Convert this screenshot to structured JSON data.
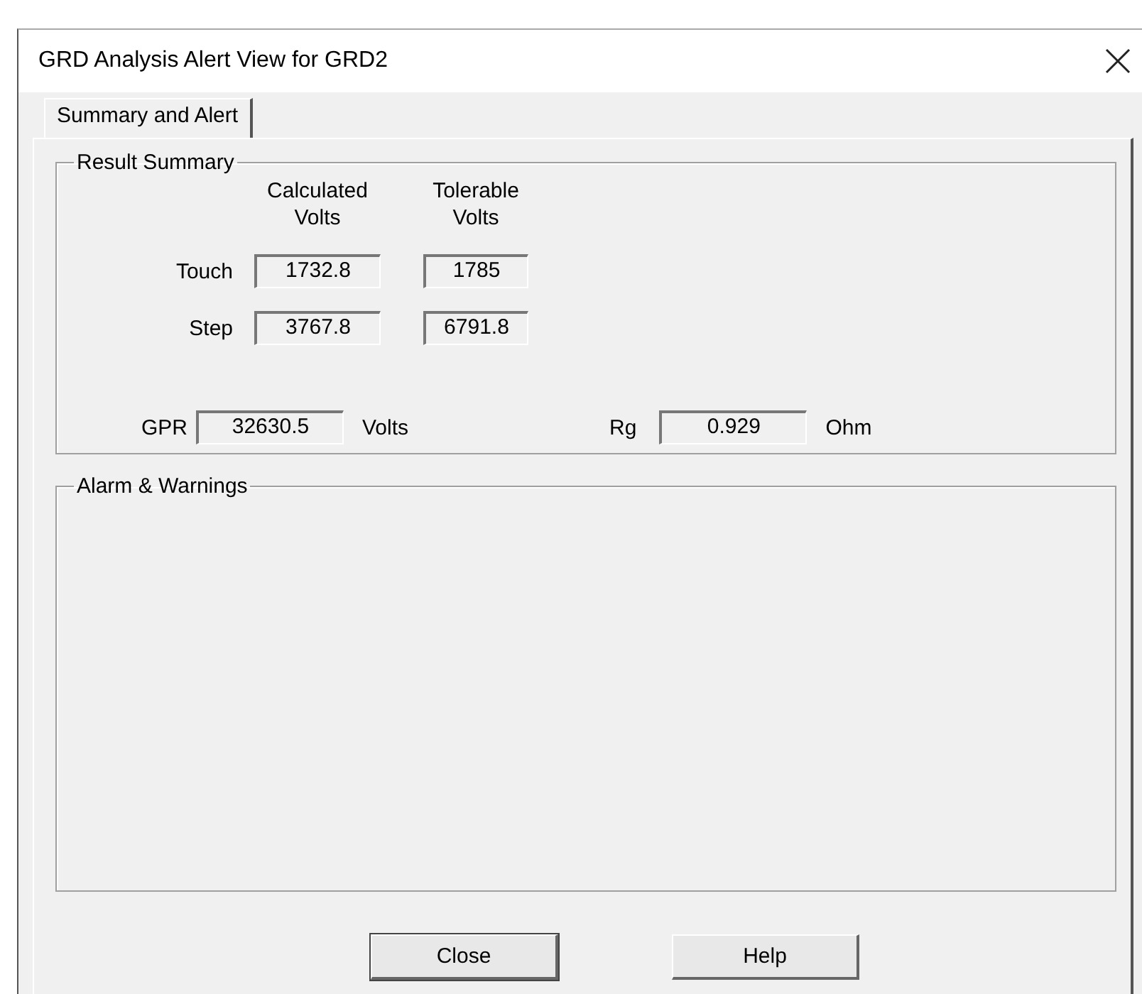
{
  "window": {
    "title": "GRD Analysis Alert View for GRD2"
  },
  "tabs": [
    {
      "label": "Summary and Alert",
      "selected": true
    }
  ],
  "result_summary": {
    "title": "Result Summary",
    "columns": [
      "Calculated\nVolts",
      "Tolerable\nVolts"
    ],
    "rows": [
      {
        "label": "Touch",
        "calculated": "1732.8",
        "tolerable": "1785"
      },
      {
        "label": "Step",
        "calculated": "3767.8",
        "tolerable": "6791.8"
      }
    ],
    "gpr": {
      "label": "GPR",
      "value": "32630.5",
      "unit": "Volts"
    },
    "rg": {
      "label": "Rg",
      "value": "0.929",
      "unit": "Ohm"
    }
  },
  "alarms": {
    "title": "Alarm & Warnings"
  },
  "buttons": [
    {
      "label": "Close",
      "default": true
    },
    {
      "label": "Help",
      "default": false
    }
  ]
}
